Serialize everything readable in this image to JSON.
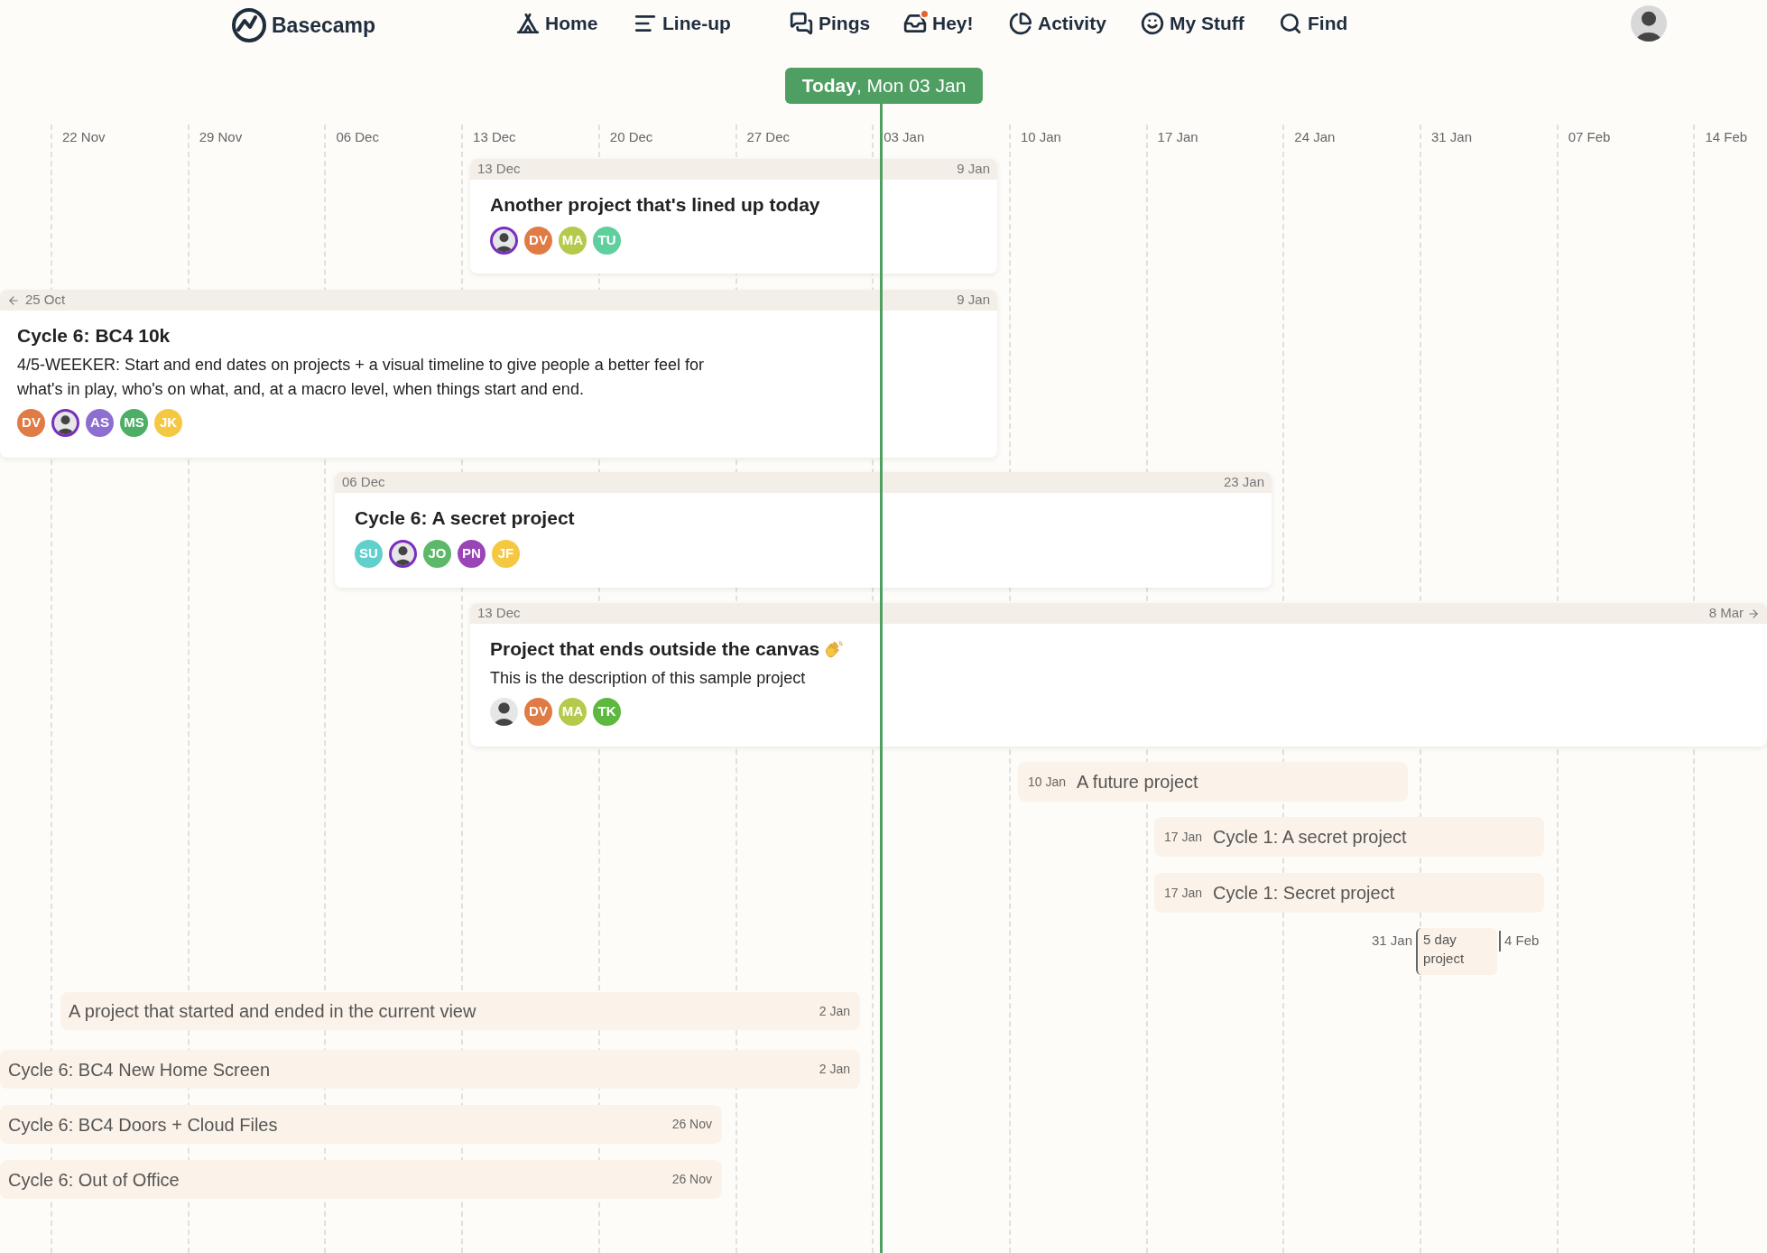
{
  "nav": {
    "logo": "Basecamp",
    "items": [
      {
        "label": "Home",
        "notification": false
      },
      {
        "label": "Line-up",
        "notification": false
      },
      {
        "label": "Pings",
        "notification": false
      },
      {
        "label": "Hey!",
        "notification": true
      },
      {
        "label": "Activity",
        "notification": false
      },
      {
        "label": "My Stuff",
        "notification": false
      },
      {
        "label": "Find",
        "notification": false
      }
    ]
  },
  "today": "**Today**, Mon 03 Jan",
  "columns": [
    "22 Nov",
    "29 Nov",
    "06 Dec",
    "13 Dec",
    "20 Dec",
    "27 Dec",
    "03 Jan",
    "10 Jan",
    "17 Jan",
    "24 Jan",
    "31 Jan",
    "07 Feb",
    "14 Feb"
  ],
  "projects": [
    {
      "kind": "card",
      "start": "13 Dec",
      "end": "9 Jan",
      "starts_before": false,
      "ends_after": false,
      "title": "Another project that's lined up today",
      "wave": false,
      "avatars": [
        {
          "kind": "photo",
          "ring": true
        },
        {
          "kind": "initials",
          "text": "DV",
          "color": "#e07b45"
        },
        {
          "kind": "initials",
          "text": "MA",
          "color": "#b5c94a"
        },
        {
          "kind": "initials",
          "text": "TU",
          "color": "#5fcf9e"
        }
      ]
    },
    {
      "kind": "card",
      "start": "25 Oct",
      "end": "9 Jan",
      "starts_before": true,
      "ends_after": false,
      "title": "Cycle 6: BC4 10k",
      "wave": false,
      "description": "4/5-WEEKER: Start and end dates on projects + a visual timeline to give people a better feel for what's in play, who's on what, and, at a macro level, when things start and end.",
      "avatars": [
        {
          "kind": "initials",
          "text": "DV",
          "color": "#e07b45"
        },
        {
          "kind": "photo",
          "ring": true
        },
        {
          "kind": "initials",
          "text": "AS",
          "color": "#8c6fd0"
        },
        {
          "kind": "initials",
          "text": "MS",
          "color": "#4caf65"
        },
        {
          "kind": "initials",
          "text": "JK",
          "color": "#f5c842"
        }
      ]
    },
    {
      "kind": "card",
      "start": "06 Dec",
      "end": "23 Jan",
      "starts_before": false,
      "ends_after": false,
      "title": "Cycle 6: A secret project",
      "wave": false,
      "avatars": [
        {
          "kind": "initials",
          "text": "SU",
          "color": "#5fd0cc"
        },
        {
          "kind": "photo",
          "ring": true
        },
        {
          "kind": "initials",
          "text": "JO",
          "color": "#5db86a"
        },
        {
          "kind": "initials",
          "text": "PN",
          "color": "#9b44b8"
        },
        {
          "kind": "initials",
          "text": "JF",
          "color": "#f5c842"
        }
      ]
    },
    {
      "kind": "card",
      "start": "13 Dec",
      "end": "8 Mar",
      "starts_before": false,
      "ends_after": true,
      "title": "Project that ends outside the canvas",
      "wave": true,
      "description": "This is the description of this sample project",
      "avatars": [
        {
          "kind": "photo",
          "ring": false
        },
        {
          "kind": "initials",
          "text": "DV",
          "color": "#e07b45"
        },
        {
          "kind": "initials",
          "text": "MA",
          "color": "#b5c94a"
        },
        {
          "kind": "initials",
          "text": "TK",
          "color": "#5cb83e"
        }
      ]
    },
    {
      "kind": "pill_start",
      "date": "10 Jan",
      "title": "A future project"
    },
    {
      "kind": "pill_start",
      "date": "17 Jan",
      "title": "Cycle 1: A secret project"
    },
    {
      "kind": "pill_start",
      "date": "17 Jan",
      "title": "Cycle 1: Secret project"
    },
    {
      "kind": "short",
      "start": "31 Jan",
      "title": "5 day project",
      "end": "4 Feb"
    },
    {
      "kind": "pill_end",
      "date": "2 Jan",
      "title": "A project that started and ended in the current view"
    },
    {
      "kind": "pill_end",
      "date": "2 Jan",
      "title": "Cycle 6: BC4 New Home Screen"
    },
    {
      "kind": "pill_end",
      "date": "26 Nov",
      "title": "Cycle 6: BC4 Doors + Cloud Files"
    },
    {
      "kind": "pill_end",
      "date": "26 Nov",
      "title": "Cycle 6: Out of Office"
    }
  ]
}
